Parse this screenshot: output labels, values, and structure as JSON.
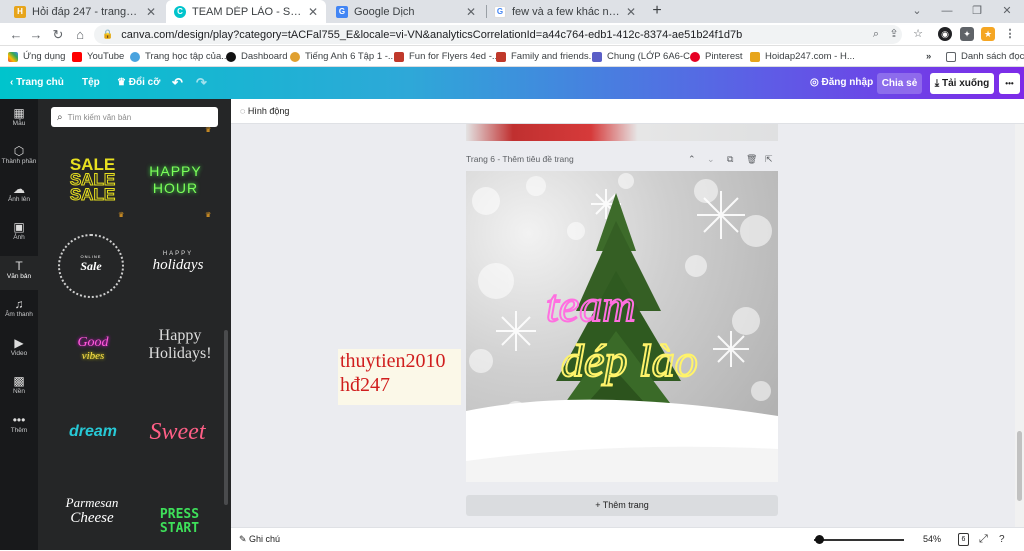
{
  "browser": {
    "tabs": [
      {
        "title": "Hỏi đáp 247 - trang tra lời",
        "icon": "hoidap-favicon"
      },
      {
        "title": "TEAM DÉP LÀO - Social Media",
        "icon": "canva-favicon"
      },
      {
        "title": "Google Dịch",
        "icon": "google-translate-favicon"
      },
      {
        "title": "few và a few khác nhau cái gì - T",
        "icon": "google-favicon"
      }
    ],
    "url": "canva.com/design/play?category=tACFal755_E&locale=vi-VN&analyticsCorrelationId=a44c764-edb1-412c-8374-ae51b24f1d7b",
    "bookmarks": [
      "Ứng dụng",
      "YouTube",
      "Trang học tập của...",
      "Dashboard",
      "Tiếng Anh 6 Tập 1 -...",
      "Fun for Flyers 4ed -...",
      "Family and friends...",
      "Chung (LỚP 6A6-C...",
      "Pinterest",
      "Hoidap247.com - H..."
    ],
    "bookmarks_more": "»",
    "reading_list": "Danh sách đọc"
  },
  "editor": {
    "home": "Trang chủ",
    "file": "Tệp",
    "resize": "Đổi cỡ",
    "login": "Đăng nhập",
    "share": "Chia sẻ",
    "download": "Tải xuống",
    "more": "•••",
    "animate": "Hình động"
  },
  "rail": [
    {
      "label": "Mẫu",
      "icon": "template-icon"
    },
    {
      "label": "Thành phần",
      "icon": "elements-icon"
    },
    {
      "label": "Ảnh lên",
      "icon": "upload-icon"
    },
    {
      "label": "Ảnh",
      "icon": "photo-icon"
    },
    {
      "label": "Văn bản",
      "icon": "text-icon"
    },
    {
      "label": "Âm thanh",
      "icon": "audio-icon"
    },
    {
      "label": "Video",
      "icon": "video-icon"
    },
    {
      "label": "Nền",
      "icon": "background-icon"
    },
    {
      "label": "Thêm",
      "icon": "more-icon"
    }
  ],
  "panel": {
    "search_placeholder": "Tìm kiếm văn bản",
    "styles": [
      {
        "text": "SALE",
        "color": "#e8e020"
      },
      {
        "text": "HAPPY HOUR",
        "color": "#7cff5a"
      },
      {
        "text": "ONLINE",
        "color": "#ffffff"
      },
      {
        "text": "Sale",
        "color": "#ffffff"
      },
      {
        "text": "HAPPY",
        "color": "#dddddd"
      },
      {
        "text": "holidays",
        "color": "#ffffff"
      },
      {
        "text": "Good",
        "color": "#ff5bd8"
      },
      {
        "text": "vibes",
        "color": "#ffe34a"
      },
      {
        "text": "Happy",
        "color": "#dddddd"
      },
      {
        "text": "Holidays!",
        "color": "#dddddd"
      },
      {
        "text": "dream",
        "color": "#27c9d6"
      },
      {
        "text": "Sweet",
        "color": "#ff5f86"
      },
      {
        "text": "Parmesan",
        "color": "#ffffff"
      },
      {
        "text": "Cheese",
        "color": "#ffffff"
      },
      {
        "text": "PRESS",
        "color": "#3ee05a"
      },
      {
        "text": "START",
        "color": "#3ee05a"
      }
    ]
  },
  "canvas": {
    "page_label": "Trang 6 - Thêm tiêu đề trang",
    "design_text_1": "team",
    "design_text_2": "dép lào",
    "add_page": "+ Thêm trang",
    "notes": "Ghi chú",
    "zoom": "54%",
    "page_count": "6"
  },
  "overlay": {
    "line1": "thuytien2010",
    "line2": "hđ247"
  }
}
